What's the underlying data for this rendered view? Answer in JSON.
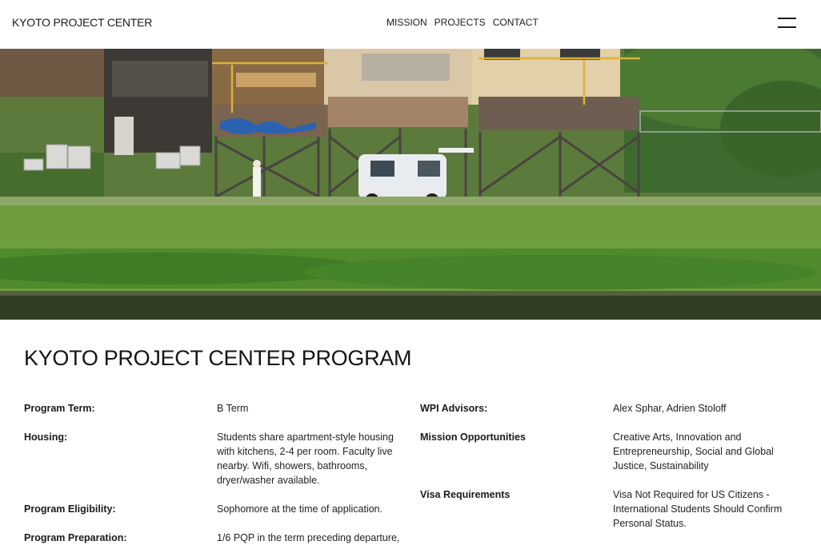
{
  "header": {
    "brand": "KYOTO PROJECT CENTER",
    "nav": [
      "MISSION",
      "PROJECTS",
      "CONTACT"
    ],
    "menu_icon": "hamburger-menu-icon"
  },
  "hero": {
    "colors": {
      "sky_trees": "#3f6a2f",
      "grass": "#6f9c3c",
      "water": "#2c3a22",
      "buildings": "#6a5a48"
    }
  },
  "program": {
    "title": "KYOTO PROJECT CENTER PROGRAM",
    "left": [
      {
        "label": "Program Term:",
        "value": "B Term"
      },
      {
        "label": "Housing:",
        "value": "Students share apartment-style housing with kitchens, 2-4 per room. Faculty live nearby. Wifi, showers, bathrooms, dryer/washer available."
      },
      {
        "label": "Program Eligibility:",
        "value": "Sophomore at the time of application."
      },
      {
        "label": "Program Preparation:",
        "value": "1/6 PQP in the term preceding departure,"
      }
    ],
    "right": [
      {
        "label": "WPI Advisors:",
        "value": "Alex Sphar, Adrien Stoloff"
      },
      {
        "label": "Mission Opportunities",
        "value": "Creative Arts, Innovation and Entrepreneurship, Social and Global Justice, Sustainability"
      },
      {
        "label": "Visa Requirements",
        "value": "Visa Not Required for US Citizens - International Students Should Confirm Personal Status."
      }
    ]
  }
}
